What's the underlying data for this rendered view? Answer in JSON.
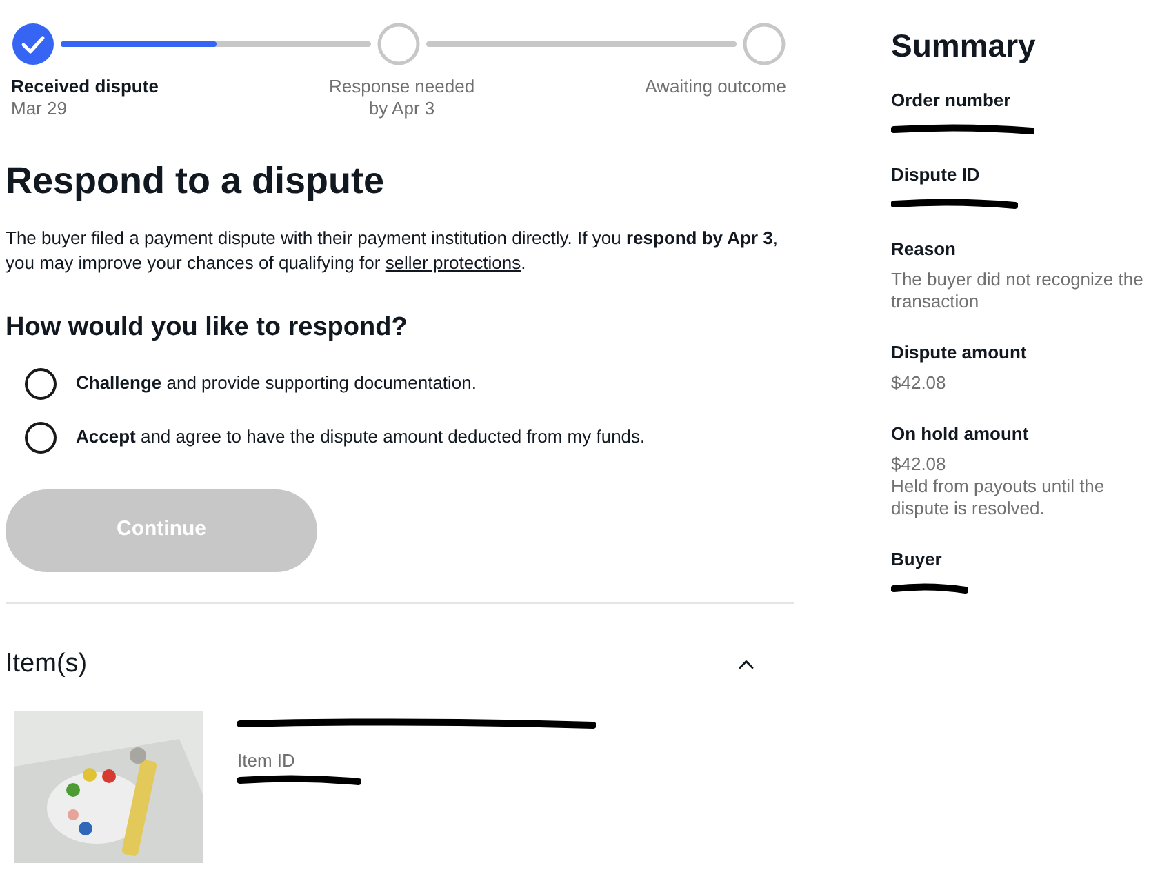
{
  "stepper": {
    "level": 0.5,
    "steps": [
      {
        "label": "Received dispute",
        "sub": "Mar 29",
        "done": true
      },
      {
        "label": "Response needed",
        "sub": "by Apr 3",
        "done": false
      },
      {
        "label": "Awaiting outcome",
        "done": false
      }
    ]
  },
  "heading": "Respond to a dispute",
  "intro": "The buyer filed a payment dispute with their payment institution directly. If you **respond by Apr 3**, you may improve your chances of qualifying for ",
  "intro_link": "seller protections",
  "intro_end": ".",
  "question": "How would you like to respond?",
  "options": [
    {
      "text": "**Challenge** and provide supporting documentation.",
      "selected": false
    },
    {
      "text": "**Accept** and agree to have the dispute amount deducted from my funds.",
      "selected": false
    }
  ],
  "continue_button": {
    "label": "Continue",
    "disabled": true
  },
  "items_section": {
    "title": "Item(s)",
    "expanded": true,
    "item": {
      "title_redacted": true,
      "id_label": "Item ID",
      "id_redacted": true
    }
  },
  "summary": {
    "title": "Summary",
    "fields": [
      {
        "label": "Order number",
        "redacted": true
      },
      {
        "label": "Dispute ID",
        "redacted": true
      },
      {
        "label": "Reason",
        "lines": [
          "The buyer did not recognize the",
          "transaction"
        ]
      },
      {
        "label": "Dispute amount",
        "lines": [
          "$42.08"
        ]
      },
      {
        "label": "On hold amount",
        "lines": [
          "$42.08",
          "Held from payouts until the",
          "dispute is resolved."
        ]
      },
      {
        "label": "Buyer",
        "redacted": true
      }
    ]
  }
}
